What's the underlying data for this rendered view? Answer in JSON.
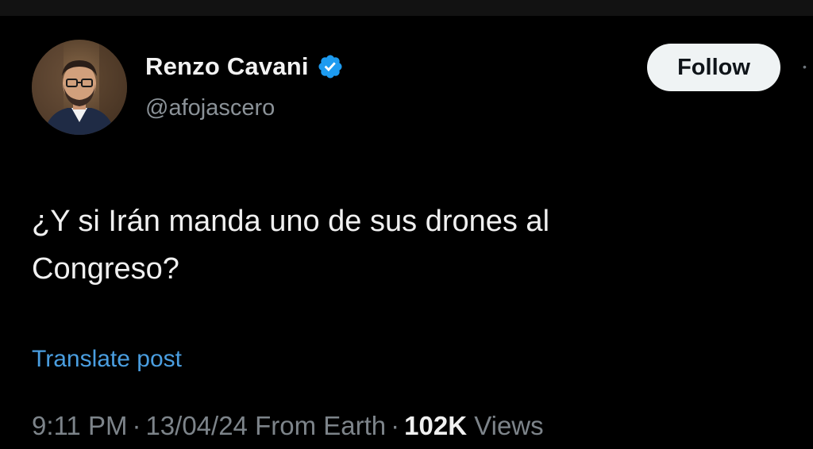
{
  "author": {
    "name": "Renzo Cavani",
    "handle": "@afojascero",
    "verified": true
  },
  "follow_label": "Follow",
  "tweet": {
    "line1": "¿Y si Irán manda uno de sus drones al",
    "line2": "Congreso?"
  },
  "translate_label": "Translate post",
  "meta": {
    "time": "9:11 PM",
    "separator": "·",
    "date": "13/04/24",
    "source": "From Earth",
    "views_count": "102K",
    "views_label": "Views"
  },
  "colors": {
    "background": "#000000",
    "verified_badge": "#1d9bf0",
    "link": "#4a9ee0",
    "follow_bg": "#eff3f4"
  },
  "icons": {
    "verified": "verified-badge-icon",
    "more": "more-icon"
  }
}
